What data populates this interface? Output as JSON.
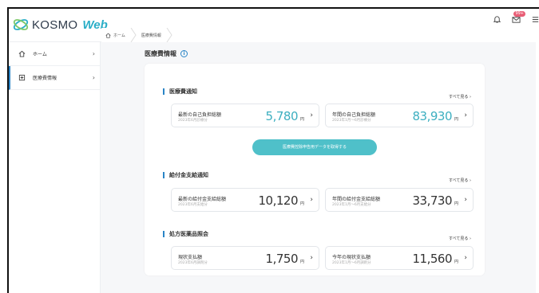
{
  "app": {
    "logo_text": "KOSMO",
    "logo_web": "Web",
    "notification_badge": "99+"
  },
  "sidebar": {
    "items": [
      {
        "label": "ホーム",
        "icon": "home-icon"
      },
      {
        "label": "医療費情報",
        "icon": "document-icon"
      }
    ]
  },
  "breadcrumb": {
    "home": "ホーム",
    "current": "医療費情報"
  },
  "page": {
    "title": "医療費情報"
  },
  "sections": [
    {
      "title": "医療費通知",
      "see_all": "すべて見る ›",
      "cards": [
        {
          "label": "最新の自己負担総額",
          "sub": "2023年6月診療分",
          "value": "5,780",
          "unit": "円"
        },
        {
          "label": "年間の自己負担総額",
          "sub": "2023年1月～6月診療分",
          "value": "83,930",
          "unit": "円"
        }
      ],
      "button": "医療費控除申告用データを取得する"
    },
    {
      "title": "給付金支給通知",
      "see_all": "すべて見る ›",
      "cards": [
        {
          "label": "最新の給付金支給総額",
          "sub": "2023年6月支給分",
          "value": "10,120",
          "unit": "円"
        },
        {
          "label": "年間の給付金支給総額",
          "sub": "2023年1月～6月支給分",
          "value": "33,730",
          "unit": "円"
        }
      ]
    },
    {
      "title": "処方医薬品照会",
      "see_all": "すべて見る ›",
      "cards": [
        {
          "label": "現状支払額",
          "sub": "2023年6月調剤分",
          "value": "1,750",
          "unit": "円"
        },
        {
          "label": "今年の現状支払額",
          "sub": "2023年1月～6月調剤分",
          "value": "11,560",
          "unit": "円"
        }
      ]
    }
  ],
  "colors": {
    "accent": "#2a85c7",
    "teal": "#3dafc0",
    "button": "#4fc0c9"
  }
}
